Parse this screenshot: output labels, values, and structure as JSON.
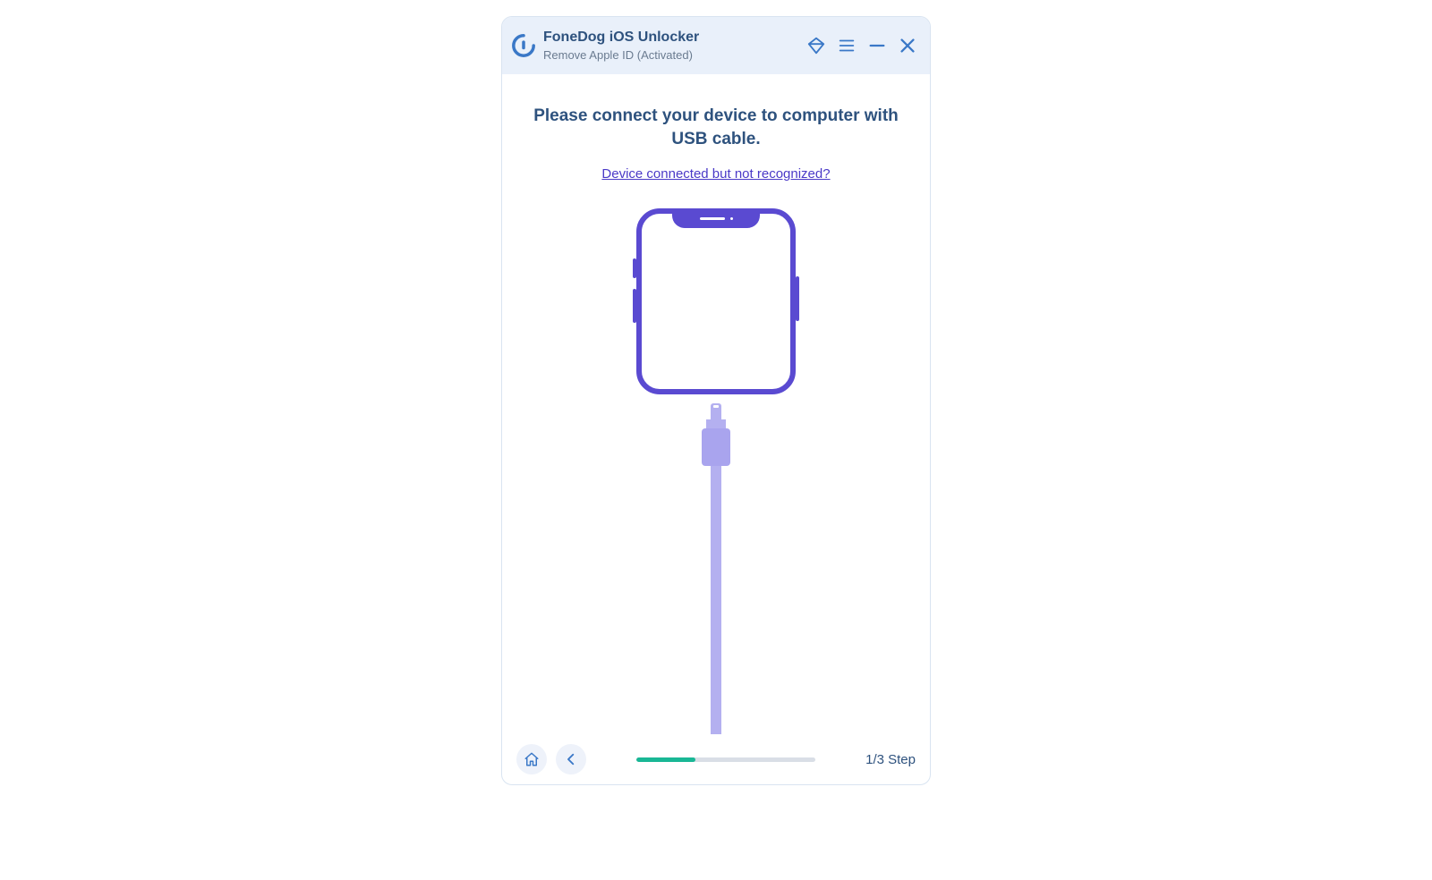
{
  "header": {
    "app_name": "FoneDog iOS Unlocker",
    "subtitle": "Remove Apple ID  (Activated)"
  },
  "main": {
    "headline": "Please connect your device to computer with USB cable.",
    "help_link": "Device connected but not recognized?"
  },
  "footer": {
    "step_label": "1/3 Step",
    "progress_percent": 33
  },
  "colors": {
    "accent_blue": "#3a78c7",
    "heading_navy": "#2e527e",
    "link_purple": "#4a39c7",
    "device_outline": "#5a4ad1",
    "cable_fill": "#a9a4ee",
    "progress_fill": "#19b795"
  }
}
